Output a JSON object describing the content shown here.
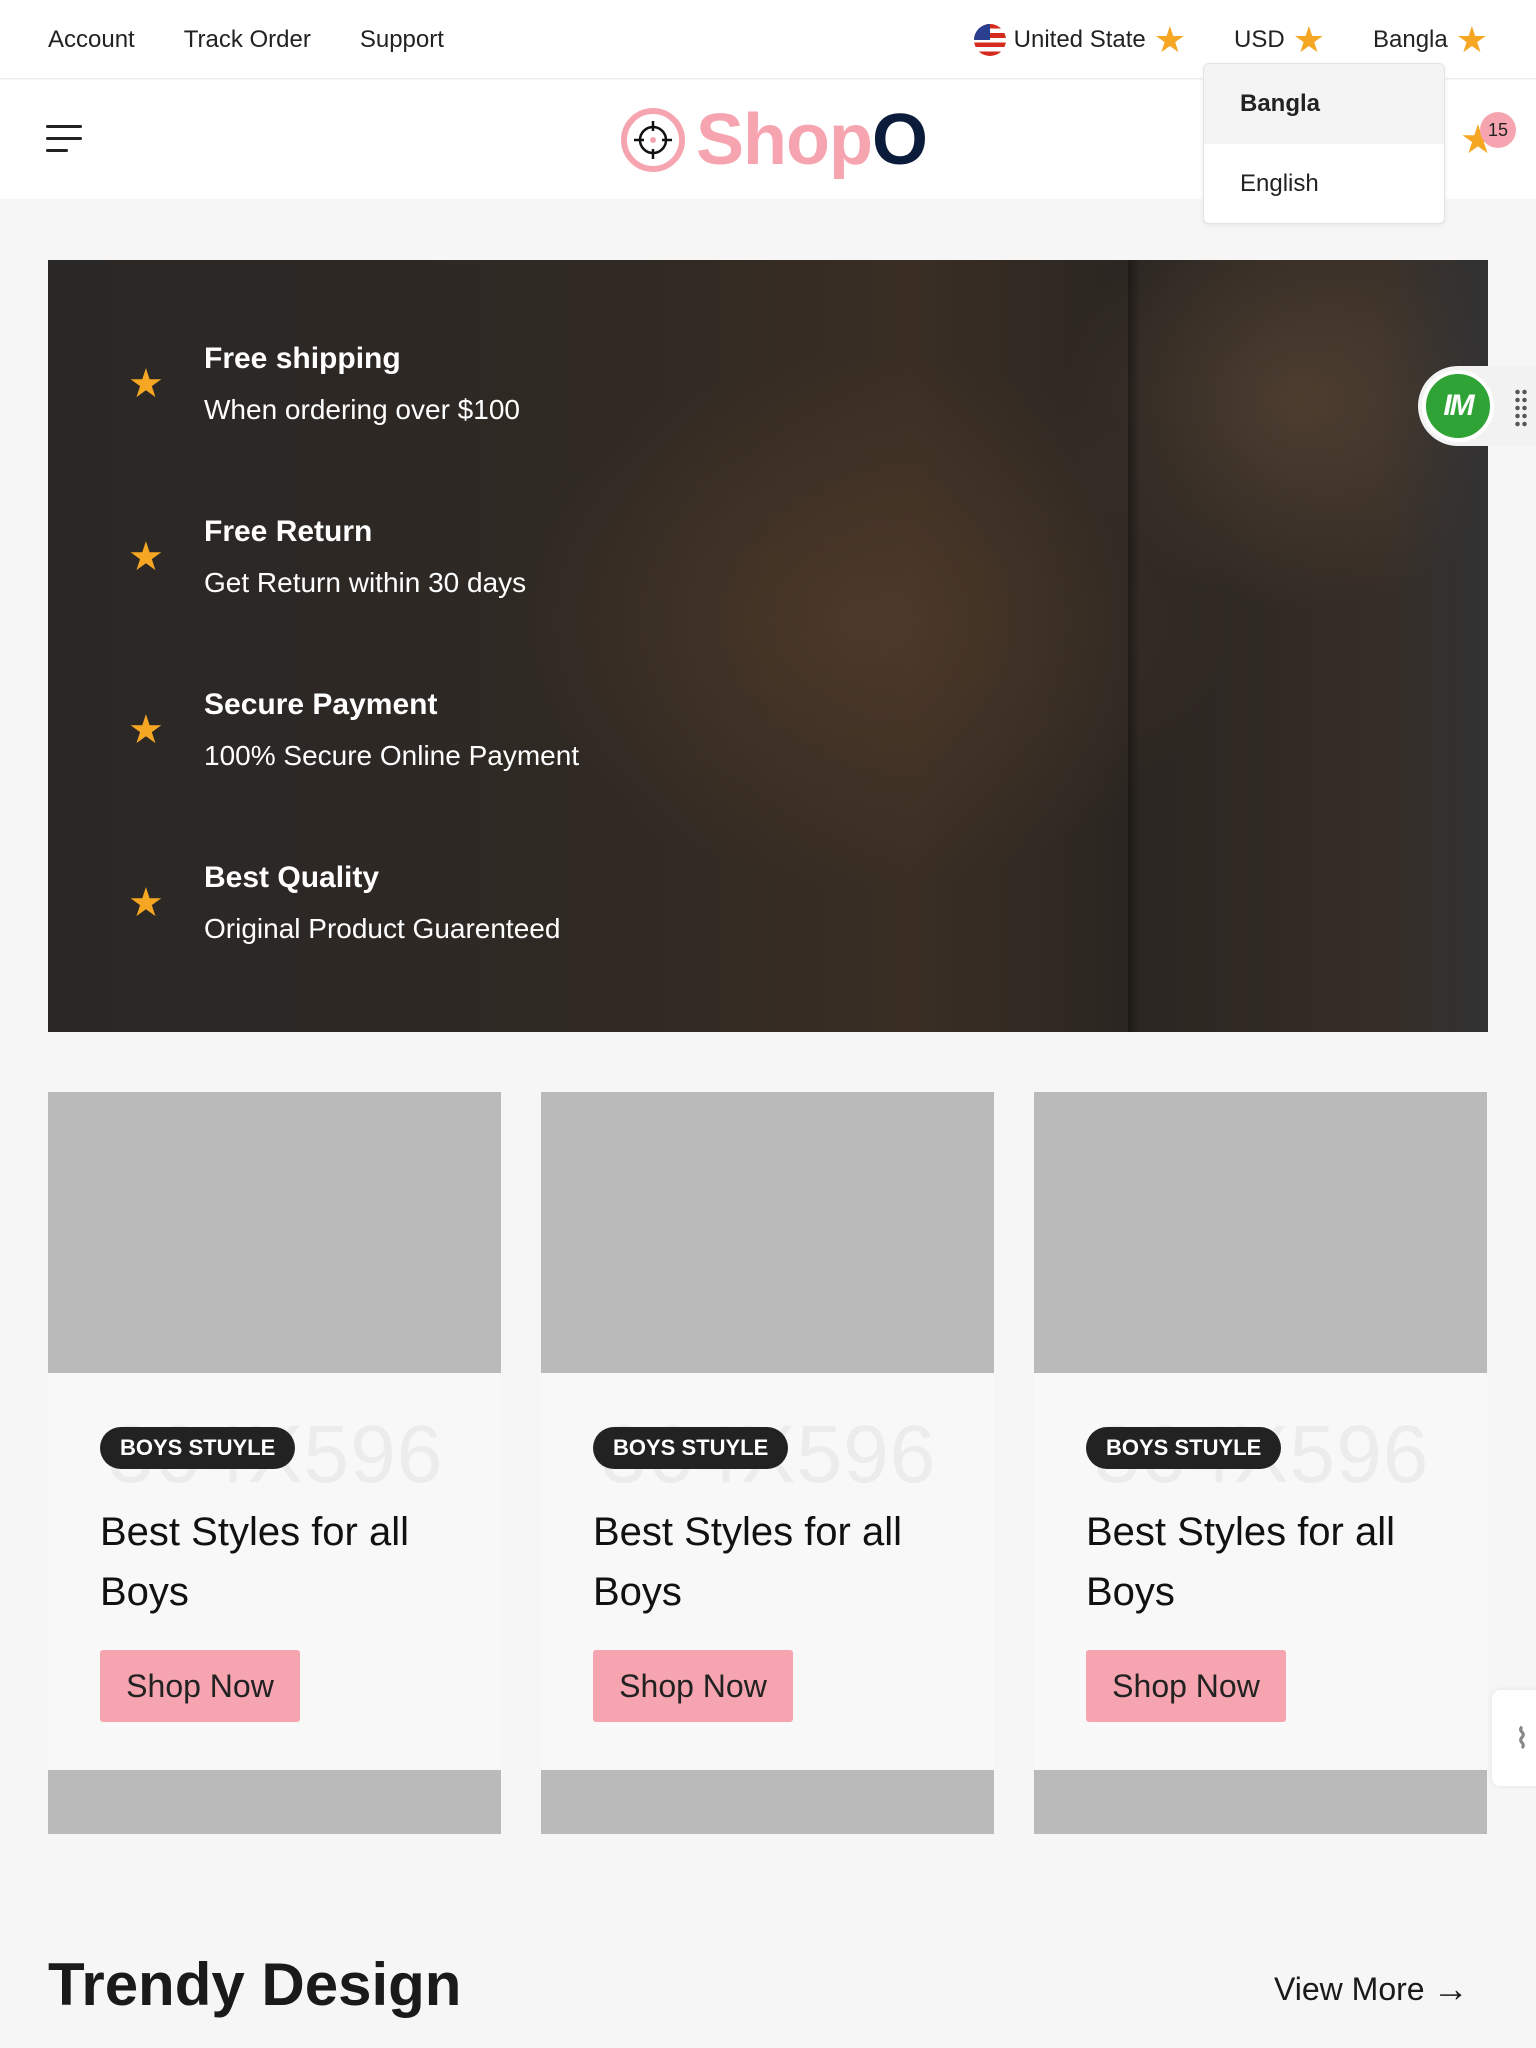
{
  "topbar": {
    "links": [
      "Account",
      "Track Order",
      "Support"
    ],
    "country": "United State",
    "currency": "USD",
    "language": "Bangla"
  },
  "language_dropdown": {
    "options": [
      "Bangla",
      "English"
    ],
    "selected": "Bangla"
  },
  "header": {
    "logo_text_main": "Shop",
    "logo_text_accent": "O",
    "cart_count": "15"
  },
  "features": [
    {
      "title": "Free shipping",
      "subtitle": "When ordering over $100"
    },
    {
      "title": "Free Return",
      "subtitle": "Get Return within 30 days"
    },
    {
      "title": "Secure Payment",
      "subtitle": "100% Secure Online Payment"
    },
    {
      "title": "Best Quality",
      "subtitle": "Original Product Guarenteed"
    }
  ],
  "side_widget": {
    "label": "IM"
  },
  "cards": [
    {
      "tag": "BOYS STUYLE",
      "watermark": "364X596",
      "title": "Best Styles for all Boys",
      "button": "Shop Now"
    },
    {
      "tag": "BOYS STUYLE",
      "watermark": "364X596",
      "title": "Best Styles for all Boys",
      "button": "Shop Now"
    },
    {
      "tag": "BOYS STUYLE",
      "watermark": "364X596",
      "title": "Best Styles for all Boys",
      "button": "Shop Now"
    }
  ],
  "trendy": {
    "title": "Trendy Design",
    "view_more": "View More"
  },
  "colors": {
    "brand_pink": "#f6a5b0",
    "brand_navy": "#0b1c3a",
    "star": "#f5a623"
  }
}
